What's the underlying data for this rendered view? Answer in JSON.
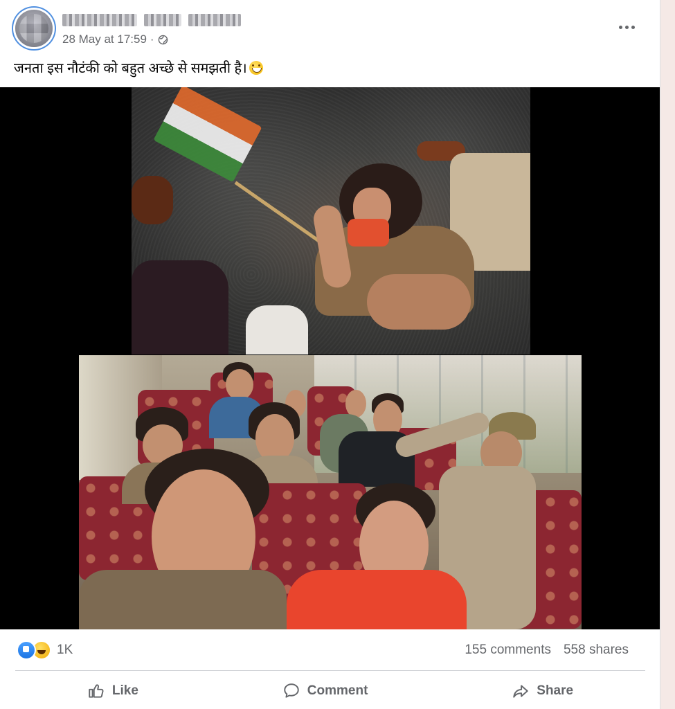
{
  "post": {
    "timestamp": "28 May at 17:59",
    "separator": "·",
    "privacy_icon": "globe-icon",
    "text": "जनता इस नौटंकी को बहुत अच्छे से समझती है।",
    "emoji": "grinning-face-icon"
  },
  "footer": {
    "reaction_icons": [
      "like-icon",
      "haha-icon"
    ],
    "reaction_count": "1K",
    "comments": "155 comments",
    "shares": "558 shares"
  },
  "actions": {
    "like_label": "Like",
    "comment_label": "Comment",
    "share_label": "Share"
  },
  "colors": {
    "accent": "#1b74e4",
    "text_secondary": "#65676b",
    "background": "#ffffff"
  }
}
